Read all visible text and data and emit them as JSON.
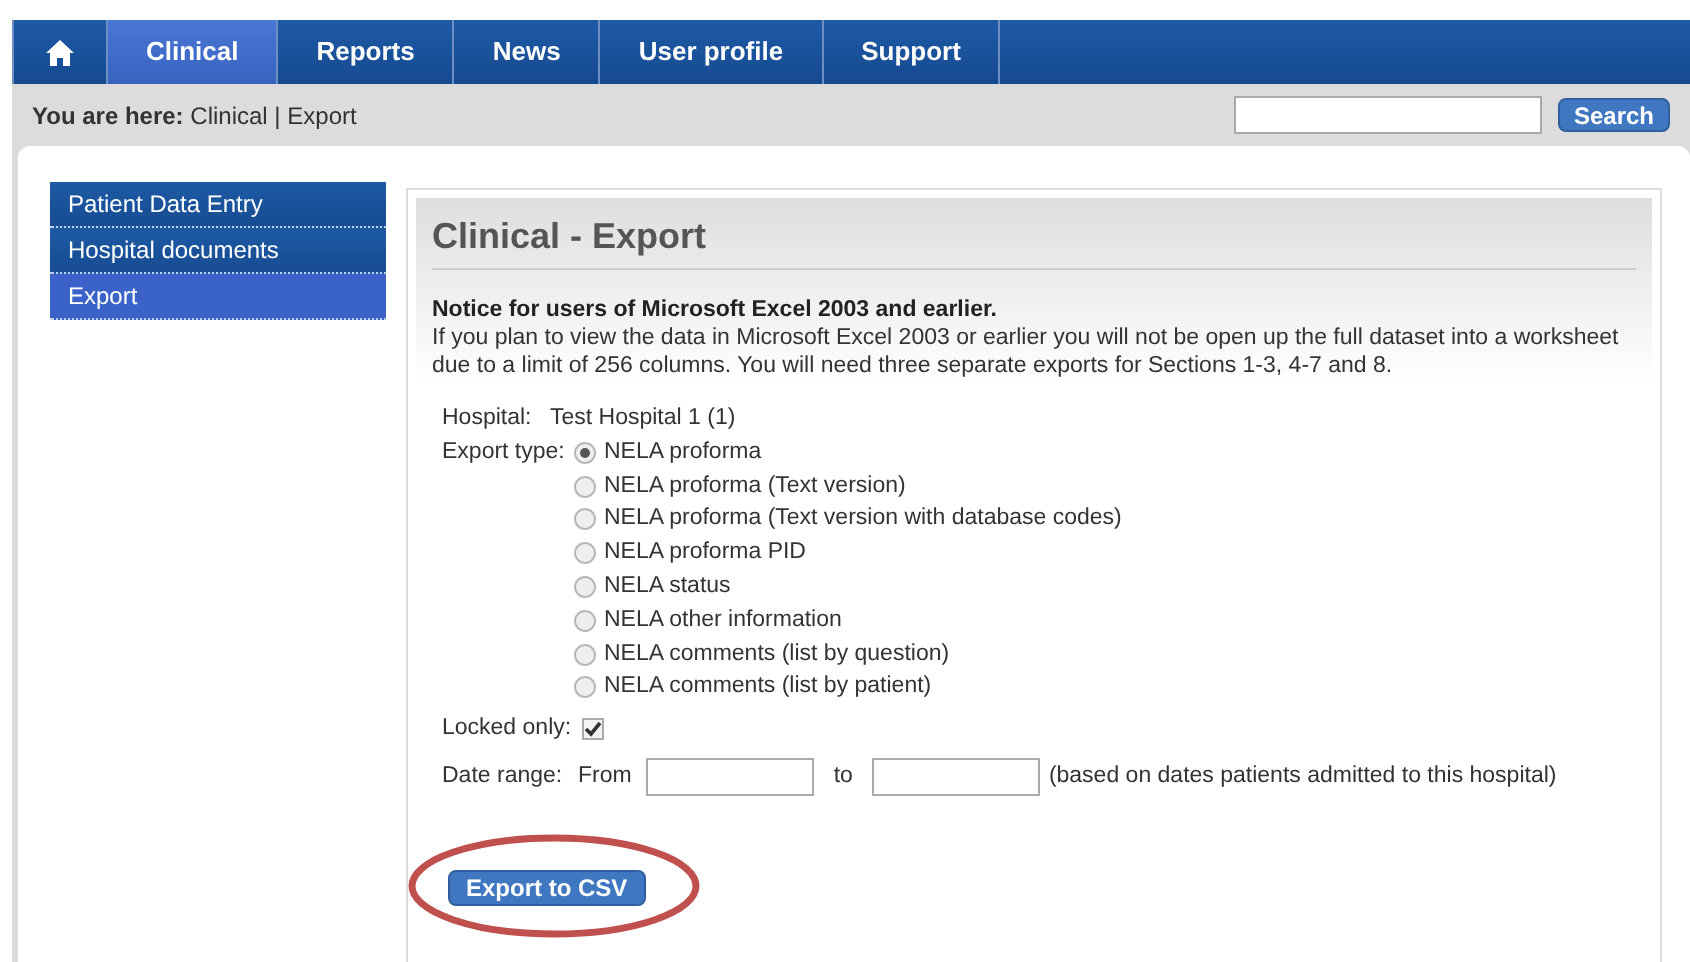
{
  "nav": {
    "tabs": [
      {
        "kind": "home",
        "selected": false
      },
      {
        "label": "Clinical",
        "selected": true
      },
      {
        "label": "Reports",
        "selected": false
      },
      {
        "label": "News",
        "selected": false
      },
      {
        "label": "User profile",
        "selected": false
      },
      {
        "label": "Support",
        "selected": false
      }
    ]
  },
  "breadcrumb": {
    "prefix": "You are here:",
    "items": [
      "Clinical",
      "Export"
    ],
    "separator": "|"
  },
  "search": {
    "button": "Search"
  },
  "sidebar": {
    "items": [
      {
        "label": "Patient Data Entry",
        "selected": false
      },
      {
        "label": "Hospital documents",
        "selected": false
      },
      {
        "label": "Export",
        "selected": true
      }
    ]
  },
  "page": {
    "title": "Clinical - Export",
    "notice_title": "Notice for users of Microsoft Excel 2003 and earlier.",
    "notice_text": "If you plan to view the data in Microsoft Excel 2003 or earlier you will not be open up the full dataset into a worksheet due to a limit of 256 columns. You will need three separate exports for Sections 1-3, 4-7 and 8.",
    "hospital": {
      "label": "Hospital:",
      "value": "Test Hospital 1 (1)"
    },
    "export_type": {
      "label": "Export type:",
      "options": [
        {
          "label": "NELA proforma",
          "selected": true
        },
        {
          "label": "NELA proforma (Text version)",
          "selected": false
        },
        {
          "label": "NELA proforma (Text version with database codes)",
          "selected": false
        },
        {
          "label": "NELA proforma PID",
          "selected": false
        },
        {
          "label": "NELA status",
          "selected": false
        },
        {
          "label": "NELA other information",
          "selected": false
        },
        {
          "label": "NELA comments (list by question)",
          "selected": false
        },
        {
          "label": "NELA comments (list by patient)",
          "selected": false
        }
      ]
    },
    "locked_only": {
      "label": "Locked only:",
      "checked": true
    },
    "date_range": {
      "label": "Date range:",
      "from": "From",
      "to": "to",
      "note": "(based on dates patients admitted to this hospital)"
    },
    "export_button": {
      "label": "Export to CSV",
      "highlighted": true
    }
  }
}
